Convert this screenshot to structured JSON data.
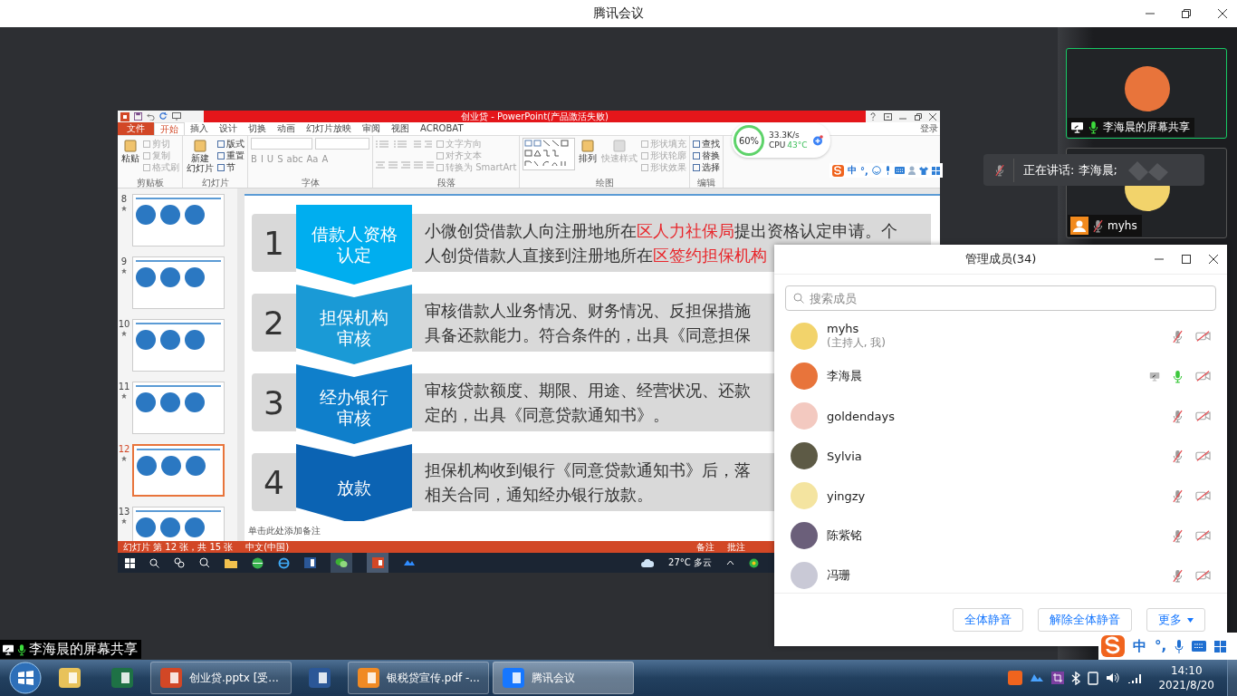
{
  "window": {
    "title": "腾讯会议"
  },
  "powerpoint": {
    "title": "创业贷 - PowerPoint(产品激活失败)",
    "sign_in": "登录",
    "tabs": [
      {
        "label": "文件",
        "kind": "backstage",
        "selected": false
      },
      {
        "label": "开始",
        "kind": "tab",
        "selected": true
      },
      {
        "label": "插入",
        "kind": "tab",
        "selected": false
      },
      {
        "label": "设计",
        "kind": "tab",
        "selected": false
      },
      {
        "label": "切换",
        "kind": "tab",
        "selected": false
      },
      {
        "label": "动画",
        "kind": "tab",
        "selected": false
      },
      {
        "label": "幻灯片放映",
        "kind": "tab",
        "selected": false
      },
      {
        "label": "审阅",
        "kind": "tab",
        "selected": false
      },
      {
        "label": "视图",
        "kind": "tab",
        "selected": false
      },
      {
        "label": "ACROBAT",
        "kind": "tab",
        "selected": false
      }
    ],
    "ribbon": [
      {
        "kind": "buttons",
        "label": "剪贴板",
        "large": [
          {
            "lines": [
              "粘贴"
            ],
            "disabled": false
          }
        ],
        "small": [
          {
            "label": "剪切",
            "disabled": true
          },
          {
            "label": "复制",
            "disabled": true
          },
          {
            "label": "格式刷",
            "disabled": true
          }
        ]
      },
      {
        "kind": "buttons",
        "label": "幻灯片",
        "large": [
          {
            "lines": [
              "新建",
              "幻灯片"
            ],
            "disabled": false
          }
        ],
        "small": [
          {
            "label": "版式",
            "disabled": false
          },
          {
            "label": "重置",
            "disabled": false
          },
          {
            "label": "节",
            "disabled": false
          }
        ]
      },
      {
        "kind": "font",
        "label": "字体",
        "glyphs": [
          "B",
          "I",
          "U",
          "S",
          "abc",
          "Aa",
          "A"
        ]
      },
      {
        "kind": "paragraph",
        "label": "段落",
        "small": [
          {
            "label": "文字方向",
            "disabled": true
          },
          {
            "label": "对齐文本",
            "disabled": true
          },
          {
            "label": "转换为 SmartArt",
            "disabled": true
          }
        ]
      },
      {
        "kind": "drawing",
        "label": "绘图",
        "large": [
          {
            "lines": [
              "排列"
            ],
            "disabled": false
          },
          {
            "lines": [
              "快速样式"
            ],
            "disabled": true
          }
        ],
        "small": [
          {
            "label": "形状填充",
            "disabled": true
          },
          {
            "label": "形状轮廓",
            "disabled": true
          },
          {
            "label": "形状效果",
            "disabled": true
          }
        ]
      },
      {
        "kind": "buttons",
        "label": "编辑",
        "small": [
          {
            "label": "查找",
            "disabled": false
          },
          {
            "label": "替换",
            "disabled": false
          },
          {
            "label": "选择",
            "disabled": false
          }
        ]
      }
    ],
    "thumbnails": [
      {
        "number": "8",
        "selected": false
      },
      {
        "number": "9",
        "selected": false
      },
      {
        "number": "10",
        "selected": false
      },
      {
        "number": "11",
        "selected": false
      },
      {
        "number": "12",
        "selected": true
      },
      {
        "number": "13",
        "selected": false
      }
    ],
    "slide": {
      "steps": [
        {
          "number": "1",
          "color": "#00aeef",
          "title_lines": [
            "借款人资格",
            "认定"
          ],
          "lines": [
            [
              {
                "text": "小微创贷借款人向注册地所在",
                "highlight": false
              },
              {
                "text": "区人力社保局",
                "highlight": true
              },
              {
                "text": "提出资格认定申请。个",
                "highlight": false
              }
            ],
            [
              {
                "text": "人创贷借款人直接到注册地所在",
                "highlight": false
              },
              {
                "text": "区签约担保机构",
                "highlight": true
              }
            ]
          ]
        },
        {
          "number": "2",
          "color": "#1a9ad6",
          "title_lines": [
            "担保机构",
            "审核"
          ],
          "lines": [
            [
              {
                "text": "审核借款人业务情况、财务情况、反担保措施",
                "highlight": false
              }
            ],
            [
              {
                "text": "具备还款能力。符合条件的，出具《同意担保",
                "highlight": false
              }
            ]
          ]
        },
        {
          "number": "3",
          "color": "#0f7fcb",
          "title_lines": [
            "经办银行",
            "审核"
          ],
          "lines": [
            [
              {
                "text": "审核贷款额度、期限、用途、经营状况、还款",
                "highlight": false
              }
            ],
            [
              {
                "text": "定的，出具《同意贷款通知书》。",
                "highlight": false
              }
            ]
          ]
        },
        {
          "number": "4",
          "color": "#0b63b3",
          "title_lines": [
            "放款"
          ],
          "lines": [
            [
              {
                "text": "担保机构收到银行《同意贷款通知书》后，落",
                "highlight": false
              }
            ],
            [
              {
                "text": "相关合同，通知经办银行放款。",
                "highlight": false
              }
            ]
          ]
        }
      ]
    },
    "notes_placeholder": "单击此处添加备注",
    "status_bar": {
      "slide_info": "幻灯片 第 12 张，共 15 张",
      "language": "中文(中国)",
      "notes": "备注",
      "comments": "批注"
    }
  },
  "perf_widget": {
    "percent": "60%",
    "speed": "33.3K/s",
    "cpu_label": "CPU",
    "cpu_temp": "43°C"
  },
  "inner_ime_bar": {
    "mode": "中",
    "punctuation": "°,"
  },
  "inner_taskbar": {
    "weather": "27°C 多云"
  },
  "video_tiles": [
    {
      "kind": "screen-share",
      "name": "李海晨的屏幕共享",
      "muted": false,
      "speaking": true
    },
    {
      "kind": "camera-off",
      "name": "myhs",
      "muted": true,
      "speaking": false
    }
  ],
  "speaking_toast": {
    "text": "正在讲话: 李海晨;"
  },
  "members_panel": {
    "title": "管理成员(34)",
    "search": {
      "placeholder": "搜索成员"
    },
    "members": [
      {
        "name": "myhs",
        "role": "(主持人, 我)",
        "muted": true,
        "sharing": false
      },
      {
        "name": "李海晨",
        "muted": false,
        "sharing": true
      },
      {
        "name": "goldendays",
        "muted": true,
        "sharing": false
      },
      {
        "name": "Sylvia",
        "muted": true,
        "sharing": false
      },
      {
        "name": "yingzy",
        "muted": true,
        "sharing": false
      },
      {
        "name": "陈紫铭",
        "muted": true,
        "sharing": false
      },
      {
        "name": "冯珊",
        "muted": true,
        "sharing": false
      }
    ],
    "buttons": [
      {
        "label": "全体静音",
        "kind": "plain"
      },
      {
        "label": "解除全体静音",
        "kind": "plain"
      },
      {
        "label": "更多",
        "kind": "menu"
      }
    ]
  },
  "share_label": {
    "text": "李海晨的屏幕共享"
  },
  "ime_bar": {
    "mode": "中",
    "punctuation": "°,"
  },
  "taskbar": {
    "items": [
      {
        "kind": "explorer",
        "selected": false
      },
      {
        "kind": "excel",
        "selected": false
      },
      {
        "kind": "powerpoint",
        "label": "创业贷.pptx [受...",
        "selected": false
      },
      {
        "kind": "word",
        "selected": false
      },
      {
        "kind": "pdf",
        "label": "银税贷宣传.pdf -...",
        "selected": false
      },
      {
        "kind": "meeting",
        "label": "腾讯会议",
        "selected": true
      }
    ],
    "clock": {
      "time": "14:10",
      "date": "2021/8/20"
    }
  }
}
